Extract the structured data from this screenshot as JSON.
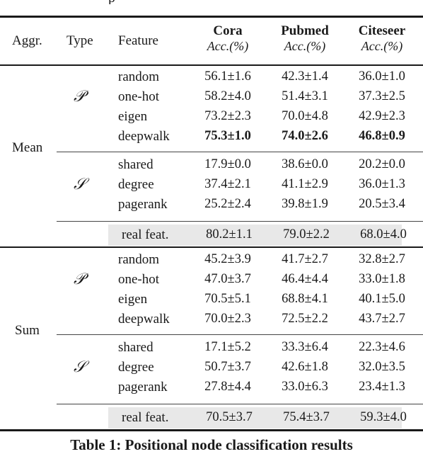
{
  "caption_top_fragment": "p",
  "header": {
    "aggr": "Aggr.",
    "type": "Type",
    "feature": "Feature",
    "datasets": [
      {
        "name": "Cora",
        "metric": "Acc.(%)"
      },
      {
        "name": "Pubmed",
        "metric": "Acc.(%)"
      },
      {
        "name": "Citeseer",
        "metric": "Acc.(%)"
      }
    ]
  },
  "type_symbols": {
    "P": "𝒫",
    "S": "𝒮"
  },
  "groups": [
    {
      "aggr": "Mean",
      "P_rows": [
        {
          "feature": "random",
          "values": [
            "56.1±1.6",
            "42.3±1.4",
            "36.0±1.0"
          ],
          "bold": false
        },
        {
          "feature": "one-hot",
          "values": [
            "58.2±4.0",
            "51.4±3.1",
            "37.3±2.5"
          ],
          "bold": false
        },
        {
          "feature": "eigen",
          "values": [
            "73.2±2.3",
            "70.0±4.8",
            "42.9±2.3"
          ],
          "bold": false
        },
        {
          "feature": "deepwalk",
          "values": [
            "75.3±1.0",
            "74.0±2.6",
            "46.8±0.9"
          ],
          "bold": true
        }
      ],
      "S_rows": [
        {
          "feature": "shared",
          "values": [
            "17.9±0.0",
            "38.6±0.0",
            "20.2±0.0"
          ]
        },
        {
          "feature": "degree",
          "values": [
            "37.4±2.1",
            "41.1±2.9",
            "36.0±1.3"
          ]
        },
        {
          "feature": "pagerank",
          "values": [
            "25.2±2.4",
            "39.8±1.9",
            "20.5±3.4"
          ]
        }
      ],
      "real": {
        "feature": "real feat.",
        "values": [
          "80.2±1.1",
          "79.0±2.2",
          "68.0±4.0"
        ]
      }
    },
    {
      "aggr": "Sum",
      "P_rows": [
        {
          "feature": "random",
          "values": [
            "45.2±3.9",
            "41.7±2.7",
            "32.8±2.7"
          ],
          "bold": false
        },
        {
          "feature": "one-hot",
          "values": [
            "47.0±3.7",
            "46.4±4.4",
            "33.0±1.8"
          ],
          "bold": false
        },
        {
          "feature": "eigen",
          "values": [
            "70.5±5.1",
            "68.8±4.1",
            "40.1±5.0"
          ],
          "bold": false
        },
        {
          "feature": "deepwalk",
          "values": [
            "70.0±2.3",
            "72.5±2.2",
            "43.7±2.7"
          ],
          "bold": false
        }
      ],
      "S_rows": [
        {
          "feature": "shared",
          "values": [
            "17.1±5.2",
            "33.3±6.4",
            "22.3±4.6"
          ]
        },
        {
          "feature": "degree",
          "values": [
            "50.7±3.7",
            "42.6±1.8",
            "32.0±3.5"
          ]
        },
        {
          "feature": "pagerank",
          "values": [
            "27.8±4.4",
            "33.0±6.3",
            "23.4±1.3"
          ]
        }
      ],
      "real": {
        "feature": "real feat.",
        "values": [
          "70.5±3.7",
          "75.4±3.7",
          "59.3±4.0"
        ]
      }
    }
  ],
  "caption": "Table 1: Positional node classification results"
}
